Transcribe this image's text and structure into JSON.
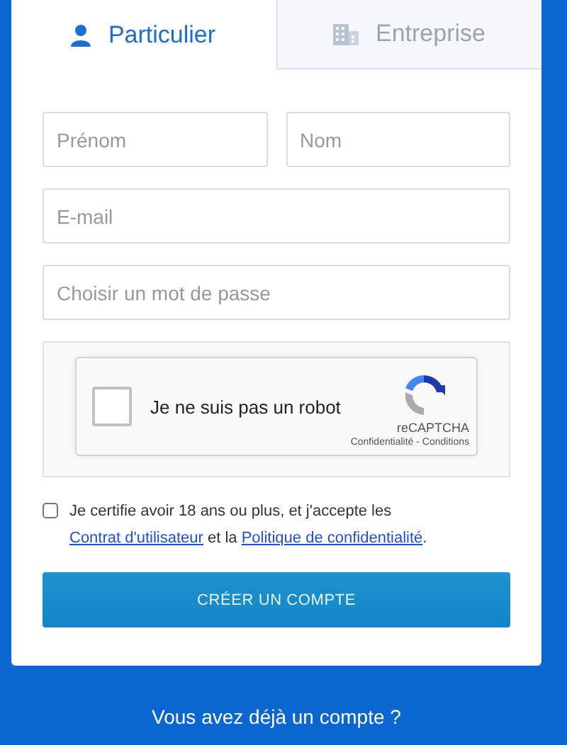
{
  "tabs": [
    {
      "label": "Particulier",
      "kind": "person",
      "selected": true
    },
    {
      "label": "Entreprise",
      "kind": "building",
      "selected": false
    }
  ],
  "fields": [
    {
      "placeholder": "Prénom",
      "kind": "half"
    },
    {
      "placeholder": "Nom",
      "kind": "half"
    },
    {
      "placeholder": "E-mail",
      "kind": "full"
    },
    {
      "placeholder": "Choisir un mot de passe",
      "kind": "full"
    }
  ],
  "captcha": {
    "label": "Je ne suis pas un robot",
    "checked": false,
    "brand": "reCAPTCHA",
    "links": "Confidentialité - Conditions"
  },
  "consent": {
    "checked": false,
    "parts": [
      {
        "kind": "text",
        "text": "Je certifie avoir 18 ans ou plus, et j'accepte les "
      },
      {
        "kind": "link",
        "text": "Contrat d'utilisateur"
      },
      {
        "kind": "text",
        "text": " et la "
      },
      {
        "kind": "link",
        "text": "Politique de confidentialité"
      },
      {
        "kind": "text",
        "text": "."
      }
    ]
  },
  "submit": "CRÉER UN COMPTE",
  "footer": "Vous avez déjà un compte ?"
}
